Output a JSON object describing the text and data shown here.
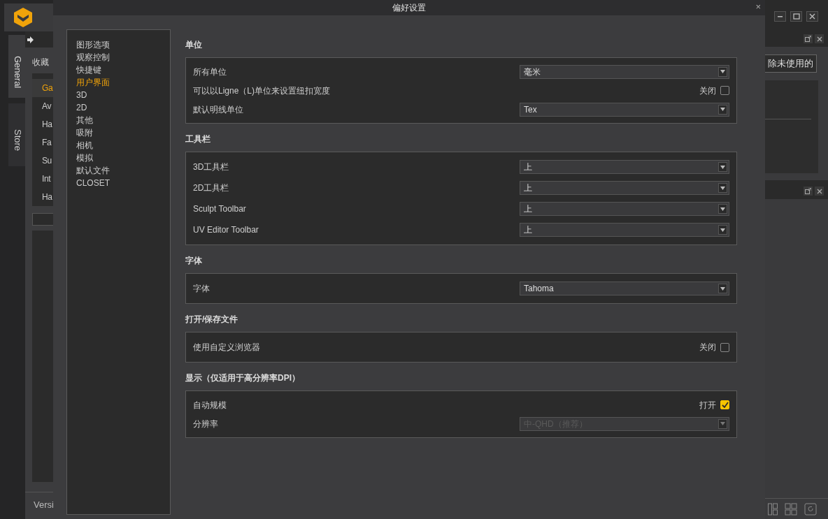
{
  "background": {
    "sidebar_tabs": [
      {
        "label": "General",
        "selected": true
      },
      {
        "label": "Store",
        "selected": false
      }
    ],
    "favorites_label": "收藏",
    "list_items": [
      {
        "label": "Ga",
        "selected": true
      },
      {
        "label": "Av",
        "selected": false
      },
      {
        "label": "Ha",
        "selected": false
      },
      {
        "label": "Fa",
        "selected": false
      },
      {
        "label": "Su",
        "selected": false
      },
      {
        "label": "Int",
        "selected": false
      },
      {
        "label": "Ha",
        "selected": false
      }
    ],
    "version_text": "Versi",
    "delete_button": "除未使用的"
  },
  "dialog": {
    "title": "偏好设置",
    "close": "×",
    "nav": [
      {
        "label": "图形选项",
        "selected": false
      },
      {
        "label": "观察控制",
        "selected": false
      },
      {
        "label": "快捷键",
        "selected": false
      },
      {
        "label": "用户界面",
        "selected": true
      },
      {
        "label": "3D",
        "selected": false
      },
      {
        "label": "2D",
        "selected": false
      },
      {
        "label": "其他",
        "selected": false
      },
      {
        "label": "吸附",
        "selected": false
      },
      {
        "label": "相机",
        "selected": false
      },
      {
        "label": "模拟",
        "selected": false
      },
      {
        "label": "默认文件",
        "selected": false
      },
      {
        "label": "CLOSET",
        "selected": false
      }
    ],
    "sections": [
      {
        "title": "单位",
        "rows": [
          {
            "kind": "select",
            "label": "所有单位",
            "value": "毫米",
            "disabled": false
          },
          {
            "kind": "toggle",
            "label": "可以以Ligne（L)单位来设置纽扣宽度",
            "state_text": "关闭",
            "checked": false
          },
          {
            "kind": "select",
            "label": "默认明线单位",
            "value": "Tex",
            "disabled": false
          }
        ]
      },
      {
        "title": "工具栏",
        "rows": [
          {
            "kind": "select",
            "label": "3D工具栏",
            "value": "上",
            "disabled": false
          },
          {
            "kind": "select",
            "label": "2D工具栏",
            "value": "上",
            "disabled": false
          },
          {
            "kind": "select",
            "label": "Sculpt Toolbar",
            "value": "上",
            "disabled": false
          },
          {
            "kind": "select",
            "label": "UV Editor Toolbar",
            "value": "上",
            "disabled": false
          }
        ]
      },
      {
        "title": "字体",
        "rows": [
          {
            "kind": "select",
            "label": "字体",
            "value": "Tahoma",
            "disabled": false
          }
        ]
      },
      {
        "title": "打开/保存文件",
        "rows": [
          {
            "kind": "toggle",
            "label": "使用自定义浏览器",
            "state_text": "关闭",
            "checked": false
          }
        ]
      },
      {
        "title": "显示（仅适用于高分辨率DPI）",
        "rows": [
          {
            "kind": "toggle",
            "label": "自动规模",
            "state_text": "打开",
            "checked": true
          },
          {
            "kind": "select",
            "label": "分辨率",
            "value": "中-QHD（推荐）",
            "disabled": true
          }
        ]
      }
    ]
  }
}
